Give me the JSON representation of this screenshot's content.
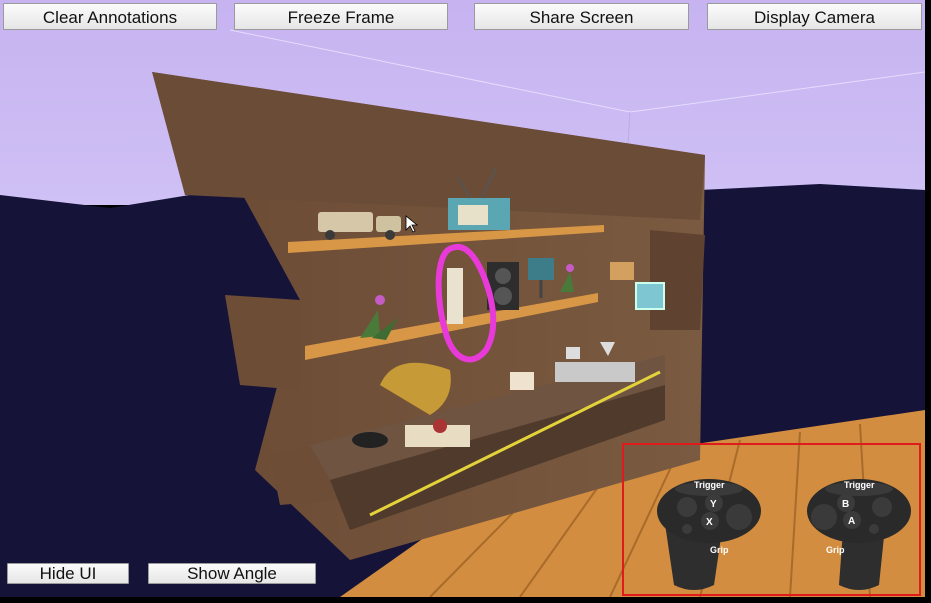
{
  "toolbar": {
    "clear_annotations": "Clear Annotations",
    "freeze_frame": "Freeze Frame",
    "share_screen": "Share Screen",
    "display_camera": "Display Camera"
  },
  "bottom_bar": {
    "hide_ui": "Hide UI",
    "show_angle": "Show Angle"
  },
  "controllers": {
    "left": {
      "trigger": "Trigger",
      "grip": "Grip",
      "buttons": [
        "Y",
        "X"
      ]
    },
    "right": {
      "trigger": "Trigger",
      "grip": "Grip",
      "buttons": [
        "B",
        "A"
      ]
    }
  },
  "colors": {
    "sky": "#c9b7f2",
    "ground": "#151336",
    "wall": "#6f5038",
    "shelf": "#d19143",
    "annotation": "#e83ad8",
    "highlight_box": "#e01b1b"
  }
}
